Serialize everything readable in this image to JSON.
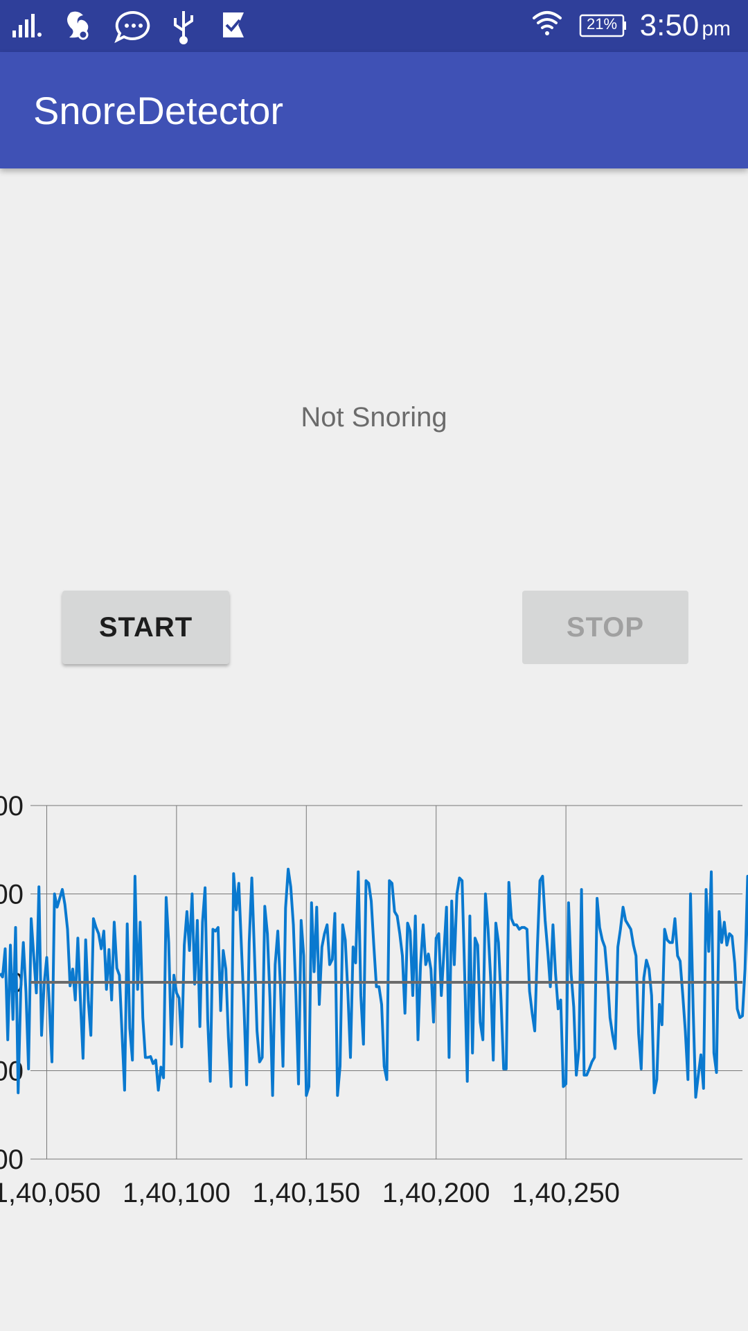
{
  "status_bar": {
    "time": "3:50",
    "ampm": "pm",
    "battery": "21%",
    "icons": [
      "signal-icon",
      "uc-browser-icon",
      "messages-icon",
      "usb-icon",
      "downloads-check-icon",
      "wifi-icon",
      "battery-icon"
    ]
  },
  "app_bar": {
    "title": "SnoreDetector"
  },
  "main": {
    "status_text": "Not Snoring",
    "start_label": "START",
    "stop_label": "STOP"
  },
  "colors": {
    "primary": "#3f51b5",
    "primary_dark": "#2f3f9a",
    "series": "#0a79cf",
    "baseline": "#6b6b6b"
  },
  "chart_data": {
    "type": "line",
    "title": "",
    "xlabel": "",
    "ylabel": "",
    "xlim": [
      140032,
      140318
    ],
    "ylim": [
      -200,
      200
    ],
    "x_ticks": [
      140050,
      140100,
      140150,
      140200,
      140250
    ],
    "x_tick_labels": [
      "1,40,050",
      "1,40,100",
      "1,40,150",
      "1,40,200",
      "1,40,250"
    ],
    "y_ticks": [
      -200,
      -100,
      0,
      100,
      200
    ],
    "y_tick_labels": [
      "00",
      "00",
      "0",
      "00",
      "00"
    ],
    "grid": true,
    "x_start": 140032,
    "x_step": 1,
    "series": [
      {
        "values": [
          10,
          6,
          38,
          -65,
          42,
          -42,
          62,
          -125,
          -8,
          45,
          -11,
          -98,
          72,
          30,
          -12,
          108,
          -60,
          -2,
          28,
          -24,
          -90,
          100,
          85,
          95,
          105,
          88,
          60,
          -4,
          15,
          -20,
          50,
          -22,
          -86,
          48,
          -20,
          -60,
          72,
          62,
          55,
          38,
          58,
          -8,
          37,
          -20,
          68,
          16,
          8,
          -58,
          -122,
          66,
          -52,
          -88,
          120,
          -8,
          68,
          -40,
          -85,
          -85,
          -84,
          -92,
          -88,
          -122,
          -96,
          -108,
          96,
          45,
          -70,
          8,
          -12,
          -18,
          -73,
          42,
          80,
          36,
          100,
          -2,
          70,
          -50,
          68,
          107,
          -42,
          -112,
          60,
          58,
          62,
          -32,
          36,
          15,
          -62,
          -118,
          123,
          82,
          112,
          40,
          -28,
          -116,
          45,
          118,
          35,
          -55,
          -90,
          -85,
          86,
          55,
          -18,
          -128,
          20,
          58,
          -2,
          -95,
          84,
          128,
          108,
          65,
          -15,
          -115,
          70,
          30,
          -128,
          -118,
          90,
          12,
          85,
          -25,
          40,
          55,
          65,
          20,
          26,
          78,
          -128,
          -95,
          65,
          48,
          -12,
          -85,
          40,
          22,
          125,
          -15,
          -70,
          115,
          112,
          92,
          42,
          -5,
          -5,
          -25,
          -95,
          -110,
          115,
          112,
          80,
          75,
          55,
          30,
          -35,
          67,
          58,
          -15,
          75,
          -65,
          20,
          65,
          20,
          32,
          15,
          -45,
          50,
          55,
          -15,
          35,
          85,
          -85,
          92,
          20,
          100,
          118,
          115,
          10,
          -112,
          75,
          -80,
          50,
          42,
          -45,
          -65,
          100,
          60,
          5,
          -88,
          67,
          45,
          -20,
          -98,
          -98,
          113,
          72,
          65,
          65,
          60,
          62,
          62,
          60,
          -10,
          -35,
          -55,
          40,
          115,
          120,
          70,
          35,
          -5,
          65,
          10,
          -30,
          -20,
          -118,
          -115,
          90,
          10,
          -28,
          -105,
          -75,
          105,
          -105,
          -105,
          -98,
          -90,
          -85,
          95,
          62,
          48,
          40,
          5,
          -40,
          -60,
          -75,
          40,
          60,
          85,
          70,
          65,
          60,
          42,
          30,
          -58,
          -98,
          5,
          25,
          15,
          -15,
          -125,
          -110,
          -25,
          -48,
          60,
          48,
          45,
          45,
          72,
          30,
          24,
          -14,
          -55,
          -110,
          100,
          -30,
          -130,
          -105,
          -82,
          -120,
          105,
          35,
          125,
          -80,
          -102,
          80,
          45,
          68,
          42,
          55,
          52,
          22,
          -30,
          -40,
          -38,
          15,
          120,
          -30,
          -90,
          -115,
          55,
          100,
          -70,
          -70,
          -85,
          -120,
          90,
          30,
          -42,
          80,
          18,
          0,
          4,
          8,
          20,
          -24,
          30,
          -38,
          -30,
          45,
          -30,
          -85,
          60,
          94,
          75,
          30,
          -10,
          35,
          -20
        ]
      }
    ]
  }
}
